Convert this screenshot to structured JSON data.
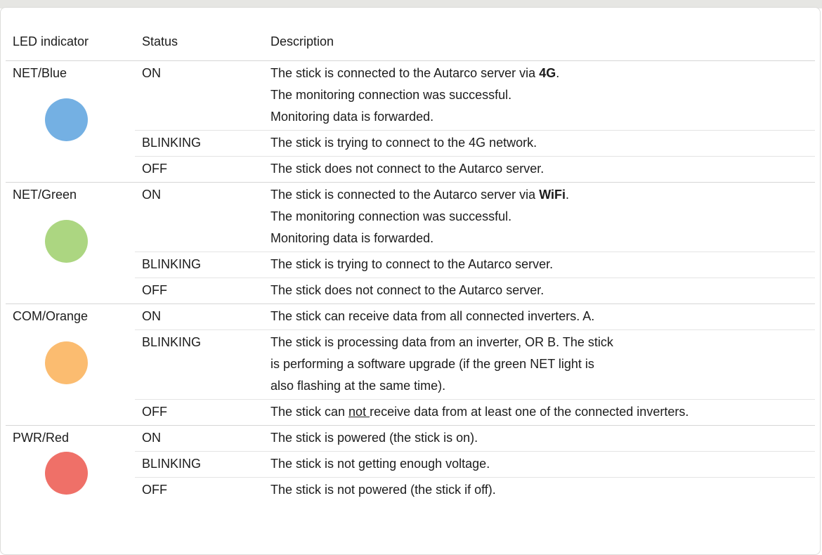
{
  "header": {
    "led": "LED indicator",
    "status": "Status",
    "description": "Description"
  },
  "colors": {
    "blue": "#74b0e3",
    "green": "#acd681",
    "orange": "#fbbc70",
    "red": "#ef7068"
  },
  "rows": {
    "net_blue": {
      "label": "NET/Blue",
      "on_status": "ON",
      "on_l1_pre": "The stick is connected to the Autarco server via ",
      "on_l1_bold": "4G",
      "on_l1_post": ".",
      "on_l2": "The monitoring connection was successful.",
      "on_l3": "Monitoring data is forwarded.",
      "blink_status": "BLINKING",
      "blink_desc": "The stick is trying to connect to the 4G network.",
      "off_status": "OFF",
      "off_desc": "The stick does not connect to the Autarco server."
    },
    "net_green": {
      "label": "NET/Green",
      "on_status": "ON",
      "on_l1_pre": "The stick is connected to the Autarco server via ",
      "on_l1_bold": "WiFi",
      "on_l1_post": ".",
      "on_l2": "The monitoring connection was successful.",
      "on_l3": "Monitoring data is forwarded.",
      "blink_status": "BLINKING",
      "blink_desc": "The stick is trying to connect to the Autarco server.",
      "off_status": "OFF",
      "off_desc": "The stick does not connect to the Autarco server."
    },
    "com_orange": {
      "label": "COM/Orange",
      "on_status": "ON",
      "on_desc": "The stick can receive data from all connected inverters. A.",
      "blink_status": "BLINKING",
      "blink_l1": "The stick is processing data from an inverter, OR B. The stick",
      "blink_l2": "is performing a software upgrade (if the green NET light is",
      "blink_l3": "also flashing at the same time).",
      "off_status": "OFF",
      "off_pre": "The stick can ",
      "off_u": "not ",
      "off_post": "receive data from at least one of the connected inverters."
    },
    "pwr_red": {
      "label": "PWR/Red",
      "on_status": "ON",
      "on_desc": "The stick is powered (the stick is on).",
      "blink_status": "BLINKING",
      "blink_desc": "The stick is not getting enough voltage.",
      "off_status": "OFF",
      "off_desc": "The stick is not powered (the stick if off)."
    }
  }
}
